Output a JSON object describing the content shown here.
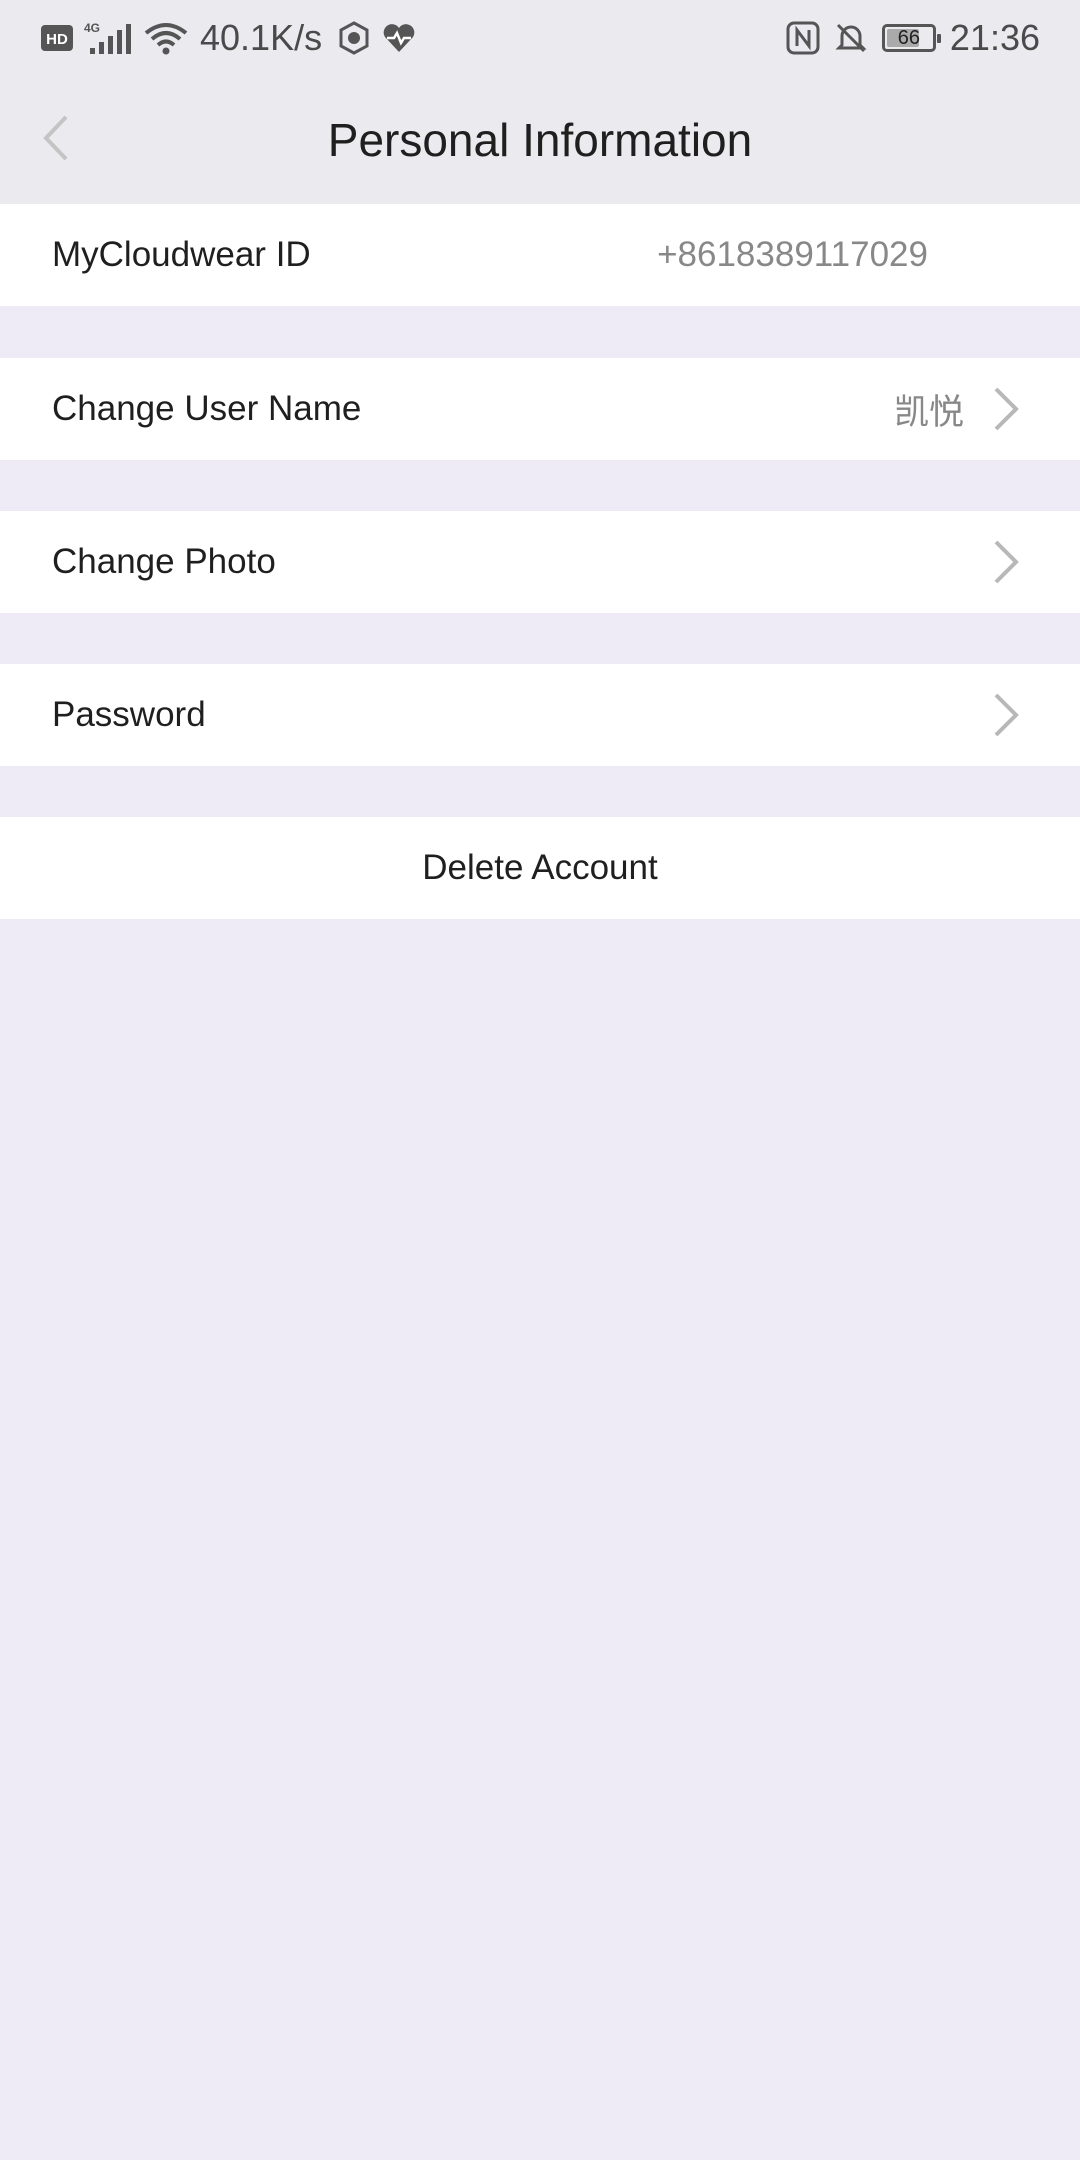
{
  "status_bar": {
    "net_speed": "40.1K/s",
    "time": "21:36",
    "battery": "66",
    "icons": [
      "hd-icon",
      "signal-4g-icon",
      "wifi-icon",
      "speedometer-icon",
      "heart-rate-icon",
      "nfc-icon",
      "bell-muted-icon",
      "battery-icon"
    ]
  },
  "header": {
    "title": "Personal Information"
  },
  "rows": {
    "id": {
      "label": "MyCloudwear ID",
      "value": "+8618389117029"
    },
    "username": {
      "label": "Change User Name",
      "value": "凯悦"
    },
    "photo": {
      "label": "Change Photo"
    },
    "password": {
      "label": "Password"
    },
    "delete": {
      "label": "Delete Account"
    }
  },
  "colors": {
    "background": "#eeebf6",
    "header": "#ebeaee",
    "row": "#ffffff",
    "chevron": "#b8b8b8",
    "value_text": "#888888"
  }
}
